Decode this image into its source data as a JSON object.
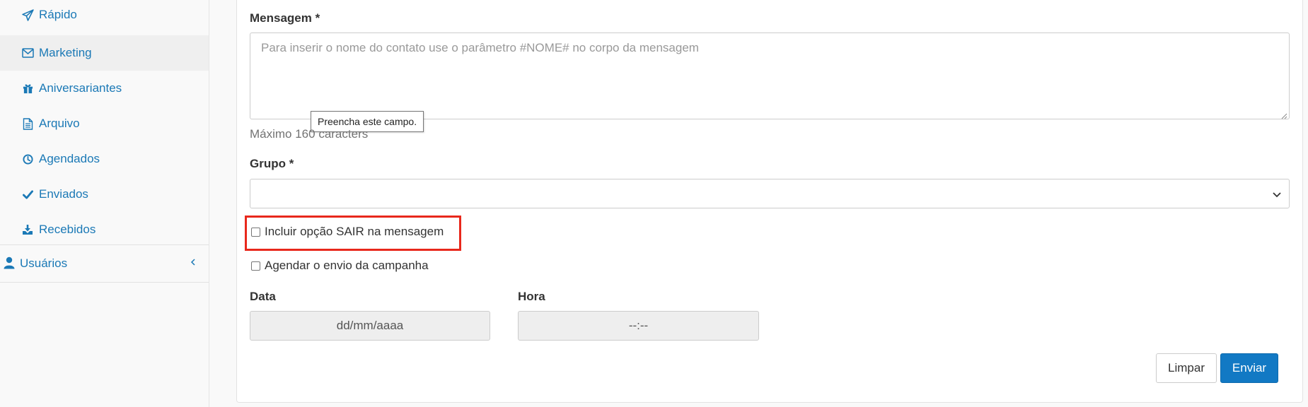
{
  "sidebar": {
    "items": [
      {
        "label": "Rápido",
        "icon": "paper-plane-icon"
      },
      {
        "label": "Marketing",
        "icon": "envelope-icon",
        "active": true
      },
      {
        "label": "Aniversariantes",
        "icon": "gift-icon"
      },
      {
        "label": "Arquivo",
        "icon": "file-text-icon"
      },
      {
        "label": "Agendados",
        "icon": "clock-icon"
      },
      {
        "label": "Enviados",
        "icon": "check-icon"
      },
      {
        "label": "Recebidos",
        "icon": "download-icon"
      }
    ],
    "group": {
      "label": "Usuários",
      "icon": "user-icon",
      "toggle_icon": "chevron-left-icon"
    }
  },
  "form": {
    "message": {
      "label": "Mensagem *",
      "placeholder": "Para inserir o nome do contato use o parâmetro #NOME# no corpo da mensagem",
      "value": "",
      "validation_tooltip": "Preencha este campo.",
      "help": "Máximo 160 caracters"
    },
    "group": {
      "label": "Grupo *",
      "selected": ""
    },
    "opt_out": {
      "label": "Incluir opção SAIR na mensagem",
      "checked": false
    },
    "schedule": {
      "label": "Agendar o envio da campanha",
      "checked": false
    },
    "date": {
      "label": "Data",
      "placeholder": "dd/mm/aaaa"
    },
    "time": {
      "label": "Hora",
      "placeholder": "--:--"
    },
    "buttons": {
      "clear": "Limpar",
      "submit": "Enviar"
    }
  },
  "colors": {
    "link": "#1b79b6",
    "primary": "#1279c4",
    "highlight": "#e8281c"
  }
}
